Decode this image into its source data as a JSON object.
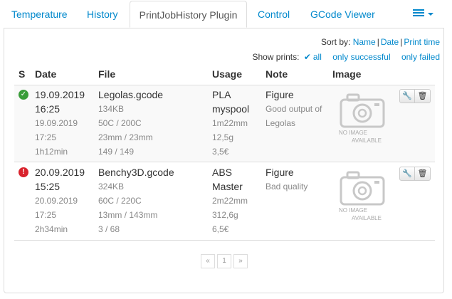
{
  "tabs": [
    {
      "label": "Temperature"
    },
    {
      "label": "History"
    },
    {
      "label": "PrintJobHistory Plugin"
    },
    {
      "label": "Control"
    },
    {
      "label": "GCode Viewer"
    }
  ],
  "sort": {
    "prefix": "Sort by:",
    "name": "Name",
    "date": "Date",
    "print_time": "Print time",
    "sep": "|"
  },
  "show": {
    "prefix": "Show prints:",
    "all": "all",
    "successful": "only successful",
    "failed": "only failed"
  },
  "headers": {
    "status": "S",
    "date": "Date",
    "file": "File",
    "usage": "Usage",
    "note": "Note",
    "image": "Image"
  },
  "jobs": [
    {
      "status": "success",
      "date": "19.09.2019",
      "time": "16:25",
      "start_date": "19.09.2019",
      "start_time": "17:25",
      "duration": "1h12min",
      "file": "Legolas.gcode",
      "size": "134KB",
      "temps": "50C / 200C",
      "dims": "23mm / 23mm",
      "layers": "149 / 149",
      "material": "PLA",
      "spool": "myspool",
      "diameter": "1m22mm",
      "weight": "12,5g",
      "cost": "3,5€",
      "note_title": "Figure",
      "note_text": "Good output of Legolas",
      "no_image_line1": "NO IMAGE",
      "no_image_line2": "AVAILABLE"
    },
    {
      "status": "failed",
      "date": "20.09.2019",
      "time": "15:25",
      "start_date": "20.09.2019",
      "start_time": "17:25",
      "duration": "2h34min",
      "file": "Benchy3D.gcode",
      "size": "324KB",
      "temps": "60C / 220C",
      "dims": "13mm / 143mm",
      "layers": "3 / 68",
      "material": "ABS",
      "spool": "Master",
      "diameter": "2m22mm",
      "weight": "312,6g",
      "cost": "6,5€",
      "note_title": "Figure",
      "note_text": "Bad quality",
      "no_image_line1": "NO IMAGE",
      "no_image_line2": "AVAILABLE"
    }
  ],
  "pagination": {
    "prev": "«",
    "page": "1",
    "next": "»"
  },
  "colors": {
    "link": "#0088cc",
    "success": "#3a9d3a",
    "failed": "#d9232d",
    "row_alt": "#f9f9f9"
  },
  "icons": {
    "status_success": "check-circle-icon",
    "status_failed": "exclamation-circle-icon",
    "edit": "wrench-icon",
    "delete": "trash-icon",
    "menu": "list-icon",
    "filter_active": "check-icon",
    "image_placeholder": "camera-icon"
  }
}
